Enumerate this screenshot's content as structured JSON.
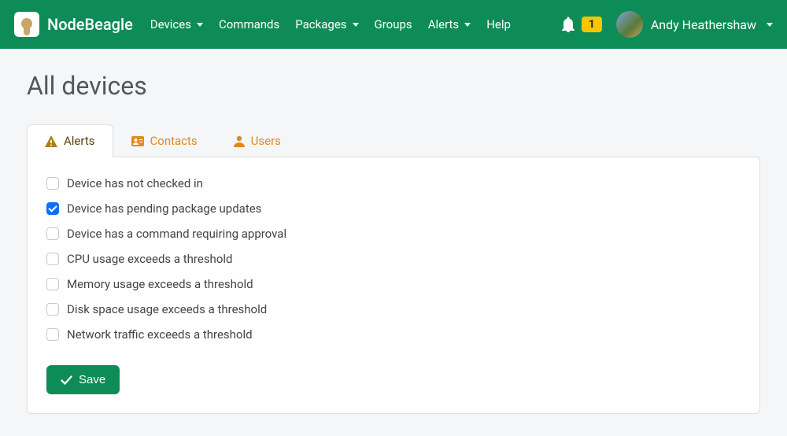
{
  "brand": {
    "name": "NodeBeagle"
  },
  "nav": {
    "items": [
      {
        "label": "Devices",
        "has_caret": true
      },
      {
        "label": "Commands",
        "has_caret": false
      },
      {
        "label": "Packages",
        "has_caret": true
      },
      {
        "label": "Groups",
        "has_caret": false
      },
      {
        "label": "Alerts",
        "has_caret": true
      },
      {
        "label": "Help",
        "has_caret": false
      }
    ]
  },
  "notifications": {
    "count": "1"
  },
  "user": {
    "name": "Andy Heathershaw"
  },
  "page": {
    "title": "All devices"
  },
  "tabs": [
    {
      "label": "Alerts",
      "icon": "warning-icon",
      "active": true
    },
    {
      "label": "Contacts",
      "icon": "contact-card-icon",
      "active": false
    },
    {
      "label": "Users",
      "icon": "user-icon",
      "active": false
    }
  ],
  "alerts": {
    "items": [
      {
        "label": "Device has not checked in",
        "checked": false
      },
      {
        "label": "Device has pending package updates",
        "checked": true
      },
      {
        "label": "Device has a command requiring approval",
        "checked": false
      },
      {
        "label": "CPU usage exceeds a threshold",
        "checked": false
      },
      {
        "label": "Memory usage exceeds a threshold",
        "checked": false
      },
      {
        "label": "Disk space usage exceeds a threshold",
        "checked": false
      },
      {
        "label": "Network traffic exceeds a threshold",
        "checked": false
      }
    ]
  },
  "actions": {
    "save_label": "Save"
  },
  "colors": {
    "brand_green": "#0e8c57",
    "badge_yellow": "#f7c600",
    "accent_orange": "#e08a1e"
  }
}
